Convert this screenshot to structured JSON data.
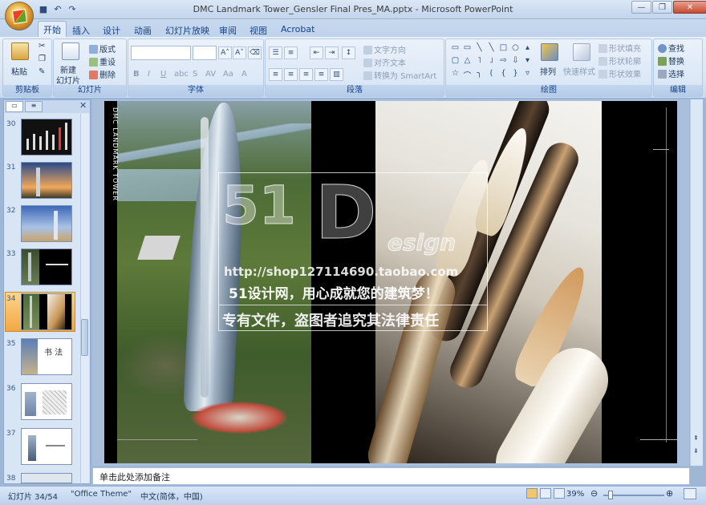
{
  "window": {
    "title": "DMC Landmark Tower_Gensler Final Pres_MA.pptx - Microsoft PowerPoint",
    "qat_icons": [
      "save-icon",
      "undo-icon",
      "redo-icon"
    ],
    "controls": [
      "minimize-icon",
      "restore-icon",
      "close-icon"
    ]
  },
  "tabs": [
    "开始",
    "插入",
    "设计",
    "动画",
    "幻灯片放映",
    "审阅",
    "视图",
    "Acrobat"
  ],
  "ribbon": {
    "clipboard": {
      "label": "剪贴板",
      "paste": "粘贴"
    },
    "slides": {
      "label": "幻灯片",
      "new_slide": "新建",
      "new_slide2": "幻灯片",
      "layout": "版式",
      "reset": "重设",
      "delete": "删除"
    },
    "font": {
      "label": "字体"
    },
    "paragraph": {
      "label": "段落",
      "text_direction": "文字方向",
      "align_text": "对齐文本",
      "smartart": "转换为 SmartArt"
    },
    "drawing": {
      "label": "绘图",
      "arrange": "排列",
      "quick_styles": "快速样式",
      "shape_fill": "形状填充",
      "shape_outline": "形状轮廓",
      "shape_effects": "形状效果"
    },
    "editing": {
      "label": "编辑",
      "find": "查找",
      "replace": "替换",
      "select": "选择"
    }
  },
  "thumbnails": [
    {
      "num": "30"
    },
    {
      "num": "31"
    },
    {
      "num": "32"
    },
    {
      "num": "33"
    },
    {
      "num": "34"
    },
    {
      "num": "35"
    },
    {
      "num": "36"
    },
    {
      "num": "37"
    },
    {
      "num": "38"
    }
  ],
  "slide": {
    "vertical_text": "DMC LANDMARK TOWER",
    "watermark": {
      "big1": "51",
      "big2": "D",
      "sub": "esign",
      "url": "http://shop127114690.taobao.com",
      "slogan": "51设计网，用心成就您的建筑梦！",
      "warning": "专有文件，盗图者追究其法律责任"
    }
  },
  "notes_placeholder": "单击此处添加备注",
  "status": {
    "slide_pos": "幻灯片 34/54",
    "theme": "\"Office Theme\"",
    "language": "中文(简体，中国)",
    "zoom": "39%"
  }
}
